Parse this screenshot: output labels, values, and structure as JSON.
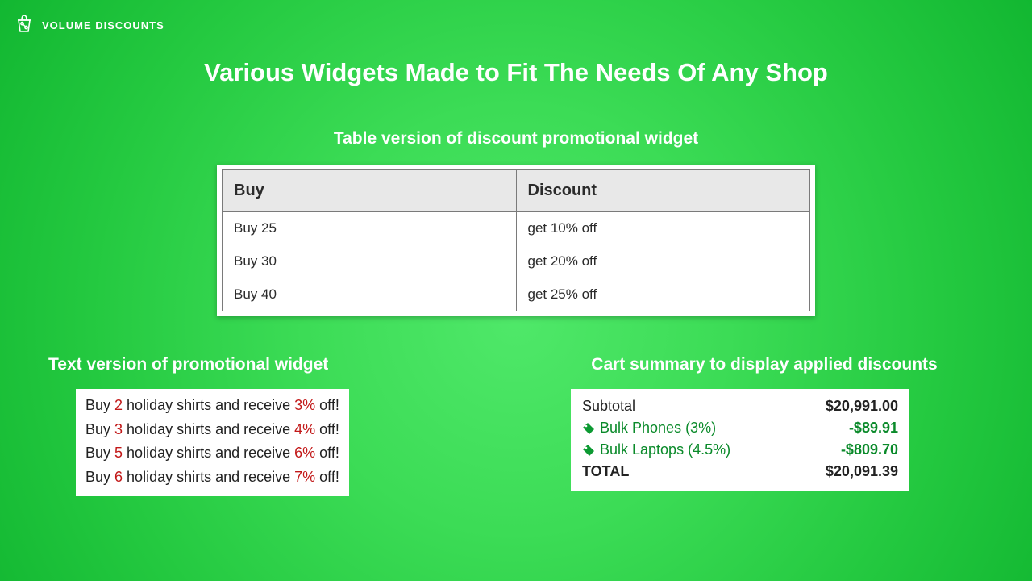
{
  "brand": {
    "text": "VOLUME DISCOUNTS"
  },
  "main_title": "Various Widgets Made to Fit The Needs Of Any Shop",
  "table_widget": {
    "title": "Table version of discount promotional widget",
    "headers": {
      "buy": "Buy",
      "discount": "Discount"
    },
    "rows": [
      {
        "buy": "Buy 25",
        "discount": "get 10% off"
      },
      {
        "buy": "Buy 30",
        "discount": "get 20% off"
      },
      {
        "buy": "Buy 40",
        "discount": "get 25% off"
      }
    ]
  },
  "text_widget": {
    "title": "Text version of promotional widget",
    "lines": [
      {
        "prefix": "Buy ",
        "qty": "2",
        "mid": " holiday shirts and receive ",
        "pct": "3%",
        "suffix": " off!"
      },
      {
        "prefix": "Buy ",
        "qty": "3",
        "mid": " holiday shirts and receive ",
        "pct": "4%",
        "suffix": " off!"
      },
      {
        "prefix": "Buy ",
        "qty": "5",
        "mid": " holiday shirts and receive ",
        "pct": "6%",
        "suffix": " off!"
      },
      {
        "prefix": "Buy ",
        "qty": "6",
        "mid": " holiday shirts and receive ",
        "pct": "7%",
        "suffix": " off!"
      }
    ]
  },
  "cart_widget": {
    "title": "Cart summary to display applied discounts",
    "subtotal": {
      "label": "Subtotal",
      "value": "$20,991.00"
    },
    "discounts": [
      {
        "label": "Bulk Phones (3%)",
        "value": "-$89.91"
      },
      {
        "label": "Bulk Laptops (4.5%)",
        "value": "-$809.70"
      }
    ],
    "total": {
      "label": "TOTAL",
      "value": "$20,091.39"
    }
  }
}
